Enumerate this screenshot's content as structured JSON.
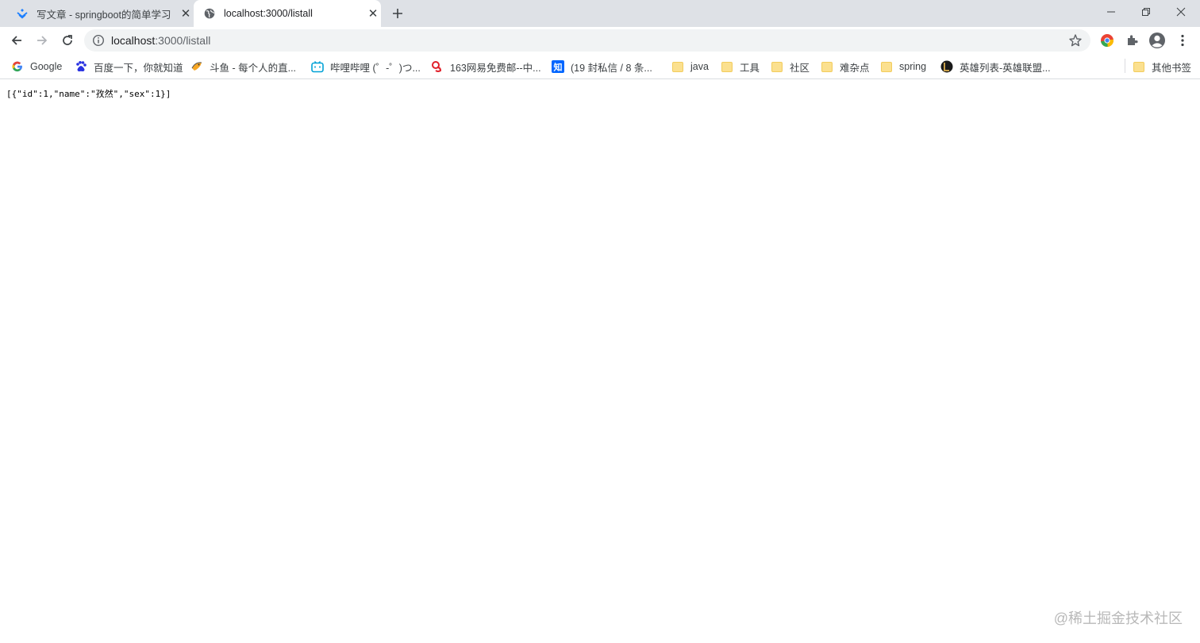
{
  "browser": {
    "tabs": [
      {
        "title": "写文章 - springboot的简单学习",
        "favicon": "juejin-logo-icon",
        "active": false
      },
      {
        "title": "localhost:3000/listall",
        "favicon": "globe-icon",
        "active": true
      }
    ],
    "address_bar": {
      "host": "localhost",
      "rest": ":3000/listall"
    },
    "bookmarks": [
      {
        "label": "Google",
        "icon": "google-icon"
      },
      {
        "label": "百度一下，你就知道",
        "icon": "baidu-paw-icon"
      },
      {
        "label": "斗鱼 - 每个人的直...",
        "icon": "douyu-fish-icon"
      },
      {
        "label": "哔哩哔哩 (゜-゜)つ...",
        "icon": "bilibili-tv-icon"
      },
      {
        "label": "163网易免费邮--中...",
        "icon": "netease-mail-icon"
      },
      {
        "label": "(19 封私信 / 8 条...",
        "icon": "zhihu-icon"
      },
      {
        "label": "java",
        "icon": "folder-icon"
      },
      {
        "label": "工具",
        "icon": "folder-icon"
      },
      {
        "label": "社区",
        "icon": "folder-icon"
      },
      {
        "label": "难杂点",
        "icon": "folder-icon"
      },
      {
        "label": "spring",
        "icon": "folder-icon"
      },
      {
        "label": "英雄列表-英雄联盟...",
        "icon": "lol-icon"
      },
      {
        "label": "其他书签",
        "icon": "folder-icon"
      }
    ]
  },
  "page": {
    "json_text": "[{\"id\":1,\"name\":\"孜然\",\"sex\":1}]",
    "watermark": "@稀土掘金技术社区"
  },
  "colors": {
    "tabstrip_bg": "#dee1e6",
    "omnibox_bg": "#f1f3f4",
    "folder": "#fbe08f"
  }
}
